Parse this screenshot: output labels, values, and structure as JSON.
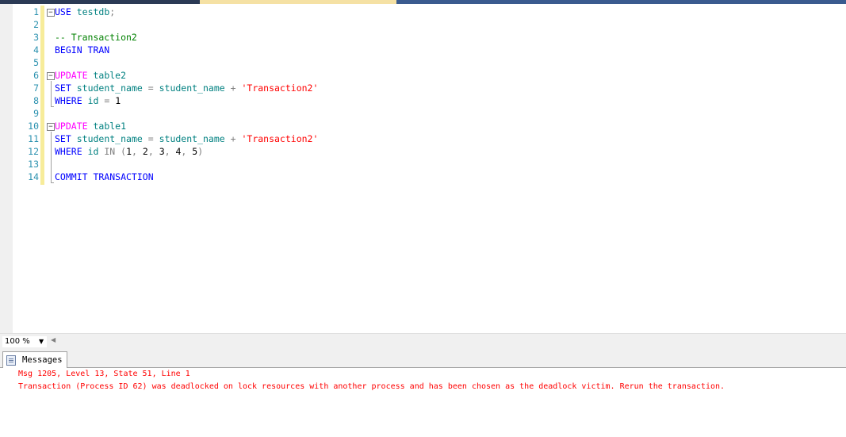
{
  "editor": {
    "lines": [
      {
        "n": "1",
        "tokens": [
          [
            "kw",
            "USE"
          ],
          [
            "blk",
            " "
          ],
          [
            "id",
            "testdb"
          ],
          [
            "op",
            ";"
          ]
        ]
      },
      {
        "n": "2",
        "tokens": []
      },
      {
        "n": "3",
        "tokens": [
          [
            "cm",
            "-- Transaction2"
          ]
        ]
      },
      {
        "n": "4",
        "tokens": [
          [
            "kw",
            "BEGIN TRAN"
          ]
        ]
      },
      {
        "n": "5",
        "tokens": []
      },
      {
        "n": "6",
        "tokens": [
          [
            "kw2",
            "UPDATE"
          ],
          [
            "blk",
            " "
          ],
          [
            "id",
            "table2"
          ]
        ]
      },
      {
        "n": "7",
        "tokens": [
          [
            "kw",
            "SET"
          ],
          [
            "blk",
            " "
          ],
          [
            "id",
            "student_name"
          ],
          [
            "op",
            " = "
          ],
          [
            "id",
            "student_name"
          ],
          [
            "op",
            " + "
          ],
          [
            "str",
            "'Transaction2'"
          ]
        ]
      },
      {
        "n": "8",
        "tokens": [
          [
            "kw",
            "WHERE"
          ],
          [
            "blk",
            " "
          ],
          [
            "id",
            "id"
          ],
          [
            "op",
            " = "
          ],
          [
            "blk",
            "1"
          ]
        ]
      },
      {
        "n": "9",
        "tokens": []
      },
      {
        "n": "10",
        "tokens": [
          [
            "kw2",
            "UPDATE"
          ],
          [
            "blk",
            " "
          ],
          [
            "id",
            "table1"
          ]
        ]
      },
      {
        "n": "11",
        "tokens": [
          [
            "kw",
            "SET"
          ],
          [
            "blk",
            " "
          ],
          [
            "id",
            "student_name"
          ],
          [
            "op",
            " = "
          ],
          [
            "id",
            "student_name"
          ],
          [
            "op",
            " + "
          ],
          [
            "str",
            "'Transaction2'"
          ]
        ]
      },
      {
        "n": "12",
        "tokens": [
          [
            "kw",
            "WHERE"
          ],
          [
            "blk",
            " "
          ],
          [
            "id",
            "id"
          ],
          [
            "blk",
            " "
          ],
          [
            "op",
            "IN"
          ],
          [
            "blk",
            " "
          ],
          [
            "op",
            "("
          ],
          [
            "blk",
            "1"
          ],
          [
            "op",
            ","
          ],
          [
            "blk",
            " 2"
          ],
          [
            "op",
            ","
          ],
          [
            "blk",
            " 3"
          ],
          [
            "op",
            ","
          ],
          [
            "blk",
            " 4"
          ],
          [
            "op",
            ","
          ],
          [
            "blk",
            " 5"
          ],
          [
            "op",
            ")"
          ]
        ]
      },
      {
        "n": "13",
        "tokens": []
      },
      {
        "n": "14",
        "tokens": [
          [
            "kw",
            "COMMIT TRANSACTION"
          ]
        ]
      }
    ]
  },
  "zoom": {
    "value": "100 %"
  },
  "results": {
    "tab_label": "Messages",
    "messages": [
      "Msg 1205, Level 13, State 51, Line 1",
      "Transaction (Process ID 62) was deadlocked on lock resources with another process and has been chosen as the deadlock victim. Rerun the transaction."
    ]
  },
  "colors": {
    "keyword": "#0000ff",
    "dml_keyword": "#ff00ff",
    "identifier": "#008080",
    "comment": "#008000",
    "string": "#ff0000",
    "line_number": "#2b91af",
    "error": "#ff0000"
  }
}
